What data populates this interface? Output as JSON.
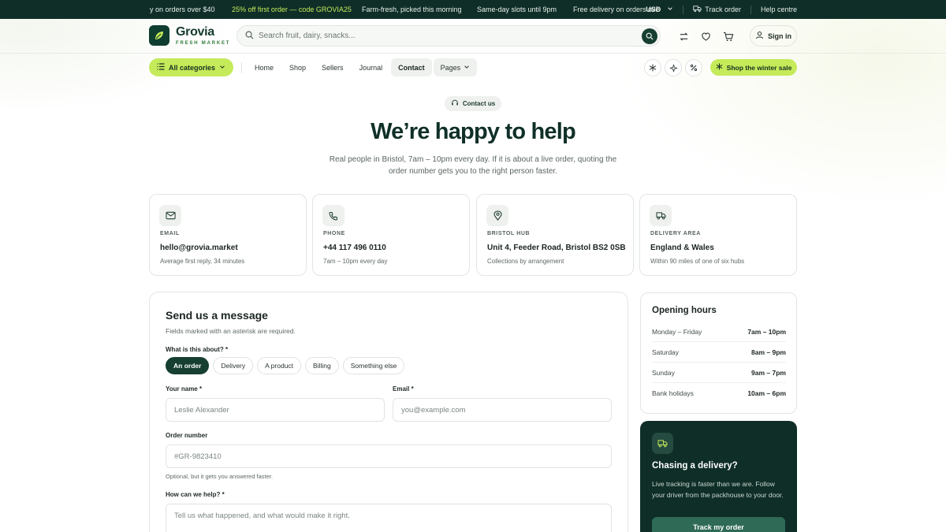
{
  "topbar": {
    "promo_1": "y on orders over $40",
    "promo_2": "25% off first order — code GROVIA25",
    "promo_3": "Farm-fresh, picked this morning",
    "promo_4": "Same-day slots until 9pm",
    "promo_5": "Free delivery on orders over",
    "currency": "USD",
    "track_order": "Track order",
    "help_centre": "Help centre"
  },
  "header": {
    "brand": "Grovia",
    "brand_sub": "FRESH MARKET",
    "search_placeholder": "Search fruit, dairy, snacks...",
    "sign_in": "Sign in"
  },
  "nav": {
    "all_categories": "All categories",
    "links": [
      "Home",
      "Shop",
      "Sellers",
      "Journal",
      "Contact",
      "Pages"
    ],
    "active": "Contact",
    "sale_button": "Shop the winter sale"
  },
  "hero": {
    "eyebrow": "Contact us",
    "title": "We’re happy to help",
    "subtitle": "Real people in Bristol, 7am – 10pm every day. If it is about a live order, quoting the order number gets you to the right person faster."
  },
  "cards": [
    {
      "label": "EMAIL",
      "value": "hello@grovia.market",
      "note": "Average first reply, 34 minutes",
      "icon": "mail-icon"
    },
    {
      "label": "PHONE",
      "value": "+44 117 496 0110",
      "note": "7am – 10pm every day",
      "icon": "phone-icon"
    },
    {
      "label": "BRISTOL HUB",
      "value": "Unit 4, Feeder Road, Bristol BS2 0SB",
      "note": "Collections by arrangement",
      "icon": "map-pin-icon"
    },
    {
      "label": "DELIVERY AREA",
      "value": "England & Wales",
      "note": "Within 90 miles of one of six hubs",
      "icon": "truck-icon"
    }
  ],
  "form": {
    "title": "Send us a message",
    "subtitle": "Fields marked with an asterisk are required.",
    "topic_label": "What is this about? *",
    "topics": [
      "An order",
      "Delivery",
      "A product",
      "Billing",
      "Something else"
    ],
    "selected_topic": "An order",
    "name_label": "Your name *",
    "name_placeholder": "Leslie Alexander",
    "email_label": "Email *",
    "email_placeholder": "you@example.com",
    "order_label": "Order number",
    "order_placeholder": "#GR-9823410",
    "order_hint": "Optional, but it gets you answered faster.",
    "help_label": "How can we help? *",
    "help_placeholder": "Tell us what happened, and what would make it right."
  },
  "hours": {
    "title": "Opening hours",
    "rows": [
      {
        "day": "Monday – Friday",
        "time": "7am – 10pm"
      },
      {
        "day": "Saturday",
        "time": "8am – 9pm"
      },
      {
        "day": "Sunday",
        "time": "9am – 7pm"
      },
      {
        "day": "Bank holidays",
        "time": "10am – 6pm"
      }
    ]
  },
  "delivery": {
    "title": "Chasing a delivery?",
    "body": "Live tracking is faster than we are. Follow your driver from the packhouse to your door.",
    "button": "Track my order"
  },
  "colors": {
    "dark_green": "#0f2e28",
    "lime": "#c5ea5a",
    "brand_green": "#163f32"
  }
}
